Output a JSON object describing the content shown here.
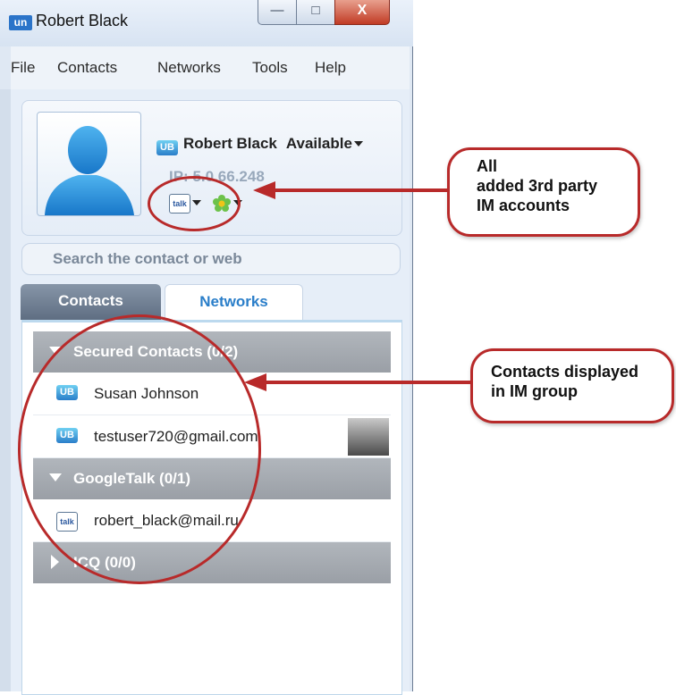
{
  "window": {
    "title": "Robert Black",
    "logo_text": "un",
    "controls": {
      "minimize": "—",
      "maximize": "□",
      "close": "X"
    }
  },
  "menu": [
    "File",
    "Contacts",
    "Networks",
    "Tools",
    "Help"
  ],
  "profile": {
    "name": "Robert Black",
    "status": "Available",
    "ip": "IP: 5.0.66.248",
    "accounts": [
      {
        "icon": "talk-icon",
        "label": "talk"
      },
      {
        "icon": "icq-flower-icon"
      }
    ],
    "brand_icon_text": "UB"
  },
  "search": {
    "placeholder": "Search the contact or web"
  },
  "tabs": [
    {
      "label": "Contacts",
      "active": true
    },
    {
      "label": "Networks",
      "active": false
    }
  ],
  "groups": [
    {
      "label": "Secured Contacts (0/2)",
      "expanded": true,
      "contacts": [
        {
          "name": "Susan Johnson",
          "icon": "ub-icon"
        },
        {
          "name": "testuser720@gmail.com",
          "icon": "ub-icon",
          "has_avatar": true
        }
      ]
    },
    {
      "label": "GoogleTalk (0/1)",
      "expanded": true,
      "contacts": [
        {
          "name": "robert_black@mail.ru",
          "icon": "talk-offline-icon"
        }
      ]
    },
    {
      "label": "ICQ (0/0)",
      "expanded": false,
      "contacts": []
    }
  ],
  "callouts": {
    "accounts": "All\nadded 3rd party\nIM accounts",
    "contacts": "Contacts displayed\nin IM group"
  },
  "colors": {
    "annotation_red": "#b82a2a",
    "accent_blue": "#2a7ec9",
    "group_gray": "#a5aab0"
  }
}
